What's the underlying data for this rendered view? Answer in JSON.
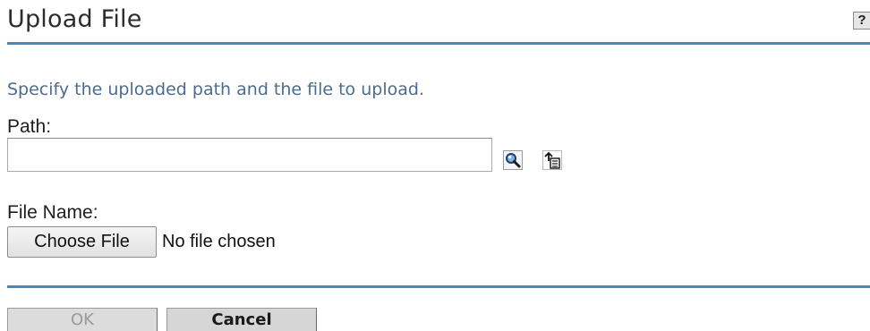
{
  "header": {
    "title": "Upload File",
    "help_label": "?"
  },
  "form": {
    "instructions": "Specify the uploaded path and the file to upload.",
    "path_label": "Path:",
    "path_value": "",
    "path_icons": [
      "search-icon",
      "browse-tree-icon"
    ],
    "file_name_label": "File Name:",
    "choose_file_label": "Choose File",
    "file_status": "No file chosen"
  },
  "actions": {
    "ok_label": "OK",
    "ok_enabled": false,
    "cancel_label": "Cancel"
  },
  "colors": {
    "accent_rule": "#4a86b8",
    "instruction_text": "#4b6c8f"
  }
}
